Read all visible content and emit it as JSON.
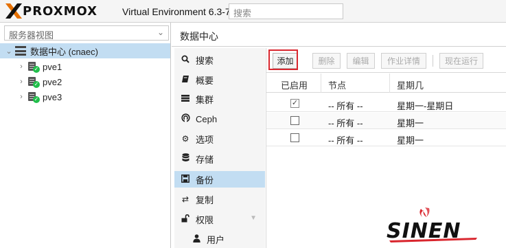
{
  "header": {
    "logo_text": "PROXMOX",
    "version": "Virtual Environment 6.3-7",
    "search_placeholder": "搜索"
  },
  "tree": {
    "view_select": "服务器视图",
    "datacenter": "数据中心 (cnaec)",
    "nodes": [
      "pve1",
      "pve2",
      "pve3"
    ]
  },
  "content": {
    "title": "数据中心"
  },
  "menu": {
    "items": [
      {
        "label": "搜索",
        "icon": "search-icon"
      },
      {
        "label": "概要",
        "icon": "book-icon"
      },
      {
        "label": "集群",
        "icon": "server-icon"
      },
      {
        "label": "Ceph",
        "icon": "ceph-icon"
      },
      {
        "label": "选项",
        "icon": "gear-icon"
      },
      {
        "label": "存储",
        "icon": "database-icon"
      },
      {
        "label": "备份",
        "icon": "floppy-icon"
      },
      {
        "label": "复制",
        "icon": "retweet-icon"
      },
      {
        "label": "权限",
        "icon": "unlock-icon"
      },
      {
        "label": "用户",
        "icon": "user-icon"
      }
    ],
    "selected": "备份"
  },
  "toolbar": {
    "add": "添加",
    "delete": "删除",
    "edit": "编辑",
    "job_detail": "作业详情",
    "run_now": "现在运行"
  },
  "grid": {
    "columns": [
      "已启用",
      "节点",
      "星期几"
    ],
    "rows": [
      {
        "enabled": true,
        "node": "-- 所有 --",
        "days": "星期一-星期日"
      },
      {
        "enabled": false,
        "node": "-- 所有 --",
        "days": "星期一"
      },
      {
        "enabled": false,
        "node": "-- 所有 --",
        "days": "星期一"
      }
    ]
  },
  "watermark": {
    "text": "SINEN"
  },
  "colors": {
    "selection": "#c2ddf2",
    "logo_orange": "#e57000",
    "status_ok": "#21bf4b",
    "highlight_red": "#d9262e"
  }
}
